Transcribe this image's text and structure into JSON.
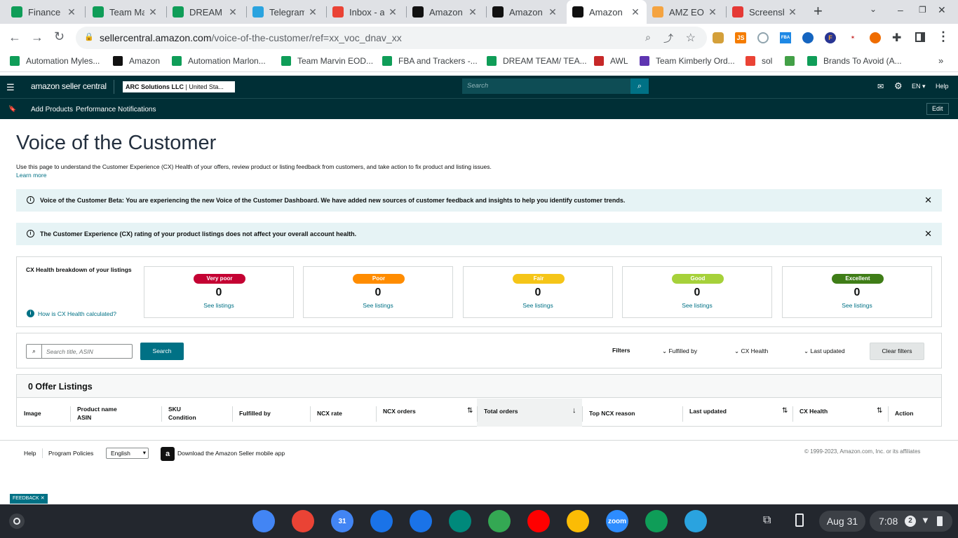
{
  "browser": {
    "tabs": [
      {
        "title": "Finance S",
        "icon": "google-sheets-icon",
        "color": "#0f9d58"
      },
      {
        "title": "Team Ma",
        "icon": "google-sheets-icon",
        "color": "#0f9d58"
      },
      {
        "title": "DREAM T",
        "icon": "google-sheets-icon",
        "color": "#0f9d58"
      },
      {
        "title": "Telegram",
        "icon": "telegram-icon",
        "color": "#2aa3df"
      },
      {
        "title": "Inbox - ar",
        "icon": "gmail-icon",
        "color": "#ea4335"
      },
      {
        "title": "Amazon",
        "icon": "amazon-icon",
        "color": "#111111"
      },
      {
        "title": "Amazon",
        "icon": "amazon-icon",
        "color": "#111111"
      },
      {
        "title": "Amazon",
        "icon": "amazon-icon",
        "color": "#111111",
        "active": true
      },
      {
        "title": "AMZ EOD",
        "icon": "app-icon",
        "color": "#f4a340"
      },
      {
        "title": "Screensh",
        "icon": "screenshot-icon",
        "color": "#e53935"
      }
    ],
    "new_tab": "+",
    "url_host": "sellercentral.amazon.com",
    "url_path": "/voice-of-the-customer/ref=xx_voc_dnav_xx",
    "bookmarks": [
      {
        "label": "Automation Myles...",
        "icon": "google-sheets-icon",
        "color": "#0f9d58"
      },
      {
        "label": "Amazon",
        "icon": "amazon-icon",
        "color": "#111111"
      },
      {
        "label": "Automation Marlon...",
        "icon": "google-sheets-icon",
        "color": "#0f9d58"
      },
      {
        "label": "Team Marvin EOD...",
        "icon": "google-sheets-icon",
        "color": "#0f9d58"
      },
      {
        "label": "FBA and Trackers -...",
        "icon": "google-sheets-icon",
        "color": "#0f9d58"
      },
      {
        "label": "DREAM TEAM/ TEA...",
        "icon": "google-sheets-icon",
        "color": "#0f9d58"
      },
      {
        "label": "AWL",
        "icon": "awl-icon",
        "color": "#c62828"
      },
      {
        "label": "Team Kimberly Ord...",
        "icon": "google-forms-icon",
        "color": "#5e35b1"
      },
      {
        "label": "sol",
        "icon": "gmail-icon",
        "color": "#ea4335"
      },
      {
        "label": "",
        "icon": "app-icon",
        "color": "#43a047"
      },
      {
        "label": "Brands To Avoid (A...",
        "icon": "google-sheets-icon",
        "color": "#0f9d58"
      }
    ]
  },
  "sc_header": {
    "logo": "amazon seller central",
    "account": "ARC Solutions LLC",
    "marketplace": "United Sta...",
    "search_placeholder": "Search",
    "language": "EN",
    "help": "Help",
    "shortcuts": [
      "Add Products",
      "Performance Notifications"
    ],
    "edit": "Edit"
  },
  "page": {
    "title": "Voice of the Customer",
    "description": "Use this page to understand the Customer Experience (CX) Health of your offers, review product or listing feedback from customers, and take action to fix product and listing issues.",
    "learn_more": "Learn more",
    "alert1": "Voice of the Customer Beta: You are experiencing the new Voice of the Customer Dashboard. We have added new sources of customer feedback and insights to help you identify customer trends.",
    "alert2": "The Customer Experience (CX) rating of your product listings does not affect your overall account health.",
    "cx_title": "CX Health breakdown of your listings",
    "cx_help": "How is CX Health calculated?",
    "cx_cards": [
      {
        "label": "Very poor",
        "count": "0",
        "link": "See listings",
        "color": "#c40233"
      },
      {
        "label": "Poor",
        "count": "0",
        "link": "See listings",
        "color": "#ff8c00"
      },
      {
        "label": "Fair",
        "count": "0",
        "link": "See listings",
        "color": "#f5c518"
      },
      {
        "label": "Good",
        "count": "0",
        "link": "See listings",
        "color": "#a6d13a"
      },
      {
        "label": "Excellent",
        "count": "0",
        "link": "See listings",
        "color": "#3f7d17"
      }
    ],
    "search_placeholder": "Search title, ASIN",
    "search_button": "Search",
    "filters_label": "Filters",
    "filters": [
      "Fulfilled by",
      "CX Health",
      "Last updated"
    ],
    "clear_filters": "Clear filters",
    "listings_title": "0 Offer Listings",
    "columns": {
      "image": "Image",
      "product": "Product name",
      "asin": "ASIN",
      "sku": "SKU",
      "condition": "Condition",
      "fulfilled": "Fulfilled by",
      "ncx_rate": "NCX rate",
      "ncx_orders": "NCX orders",
      "total_orders": "Total orders",
      "top_reason": "Top NCX reason",
      "last_updated": "Last updated",
      "cx_health": "CX Health",
      "action": "Action"
    }
  },
  "footer": {
    "help": "Help",
    "policies": "Program Policies",
    "language": "English",
    "download": "Download the Amazon Seller mobile app",
    "copyright": "© 1999-2023, Amazon.com, Inc. or its affiliates",
    "feedback": "FEEDBACK"
  },
  "shelf": {
    "apps": [
      {
        "name": "chrome-icon",
        "color": "#4285f4"
      },
      {
        "name": "gmail-icon",
        "color": "#ea4335"
      },
      {
        "name": "calendar-icon",
        "color": "#4285f4",
        "text": "31"
      },
      {
        "name": "files-icon",
        "color": "#1a73e8"
      },
      {
        "name": "messages-icon",
        "color": "#1a73e8"
      },
      {
        "name": "meet-icon",
        "color": "#00897b"
      },
      {
        "name": "play-store-icon",
        "color": "#34a853"
      },
      {
        "name": "youtube-icon",
        "color": "#ff0000"
      },
      {
        "name": "photos-icon",
        "color": "#fbbc05"
      },
      {
        "name": "zoom-icon",
        "color": "#2d8cff",
        "text": "zoom"
      },
      {
        "name": "sheets-icon",
        "color": "#0f9d58"
      },
      {
        "name": "telegram-icon",
        "color": "#2aa3df"
      }
    ],
    "date": "Aug 31",
    "time": "7:08",
    "notifications": "2"
  }
}
